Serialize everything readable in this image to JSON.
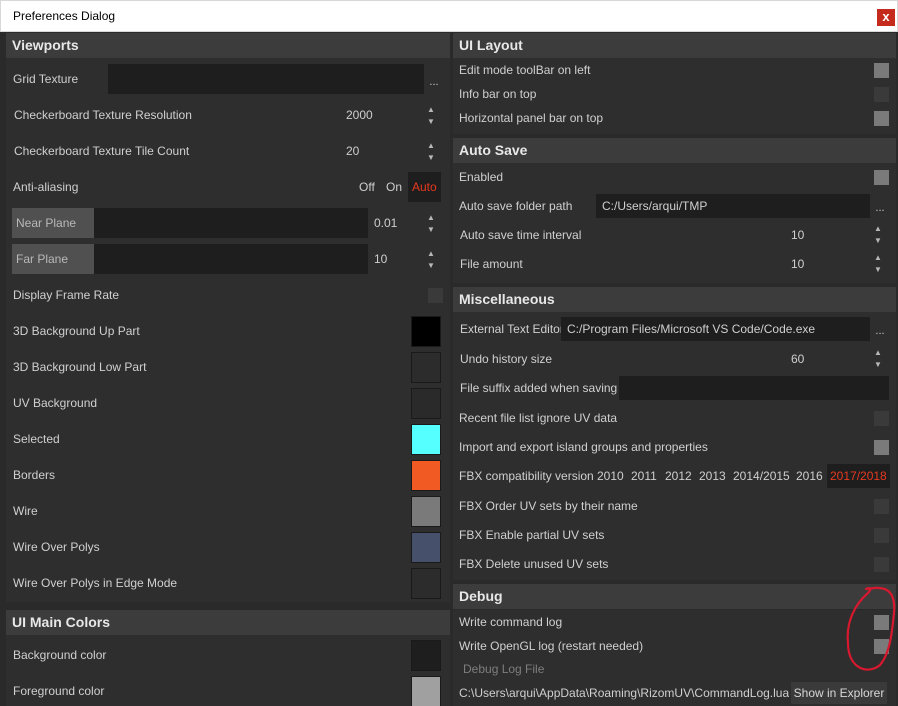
{
  "window": {
    "title": "Preferences Dialog",
    "close_glyph": "x"
  },
  "viewports": {
    "header": "Viewports",
    "grid_texture": {
      "label": "Grid Texture",
      "value": "",
      "browse": "..."
    },
    "checker_res": {
      "label": "Checkerboard Texture Resolution",
      "value": "2000"
    },
    "checker_tile": {
      "label": "Checkerboard Texture Tile Count",
      "value": "20"
    },
    "antialiasing": {
      "label": "Anti-aliasing",
      "options": [
        "Off",
        "On",
        "Auto"
      ],
      "selected": "Auto"
    },
    "near_plane": {
      "label": "Near Plane",
      "value": "0.01"
    },
    "far_plane": {
      "label": "Far Plane",
      "value": "10"
    },
    "display_frame_rate": {
      "label": "Display Frame Rate",
      "checked": false
    },
    "colors": [
      {
        "label": "3D Background Up Part",
        "color": "#000000"
      },
      {
        "label": "3D Background Low Part",
        "color": "#2c2c2c"
      },
      {
        "label": "UV Background",
        "color": "#2a2a2a"
      },
      {
        "label": "Selected",
        "color": "#55ffff"
      },
      {
        "label": "Borders",
        "color": "#f25a24"
      },
      {
        "label": "Wire",
        "color": "#7a7a7a"
      },
      {
        "label": "Wire Over Polys",
        "color": "#46506a"
      },
      {
        "label": "Wire Over Polys in Edge Mode",
        "color": "#2c2c2c"
      }
    ]
  },
  "ui_main_colors": {
    "header": "UI Main Colors",
    "colors": [
      {
        "label": "Background color",
        "color": "#1e1e1e"
      },
      {
        "label": "Foreground color",
        "color": "#a0a0a0"
      }
    ]
  },
  "ui_layout": {
    "header": "UI Layout",
    "items": [
      {
        "label": "Edit mode toolBar on left",
        "checked": true
      },
      {
        "label": "Info bar on top",
        "checked": false
      },
      {
        "label": "Horizontal panel bar on top",
        "checked": true
      }
    ]
  },
  "auto_save": {
    "header": "Auto Save",
    "enabled": {
      "label": "Enabled",
      "checked": true
    },
    "folder": {
      "label": "Auto save folder path",
      "value": "C:/Users/arqui/TMP",
      "browse": "..."
    },
    "interval": {
      "label": "Auto save time interval",
      "value": "10"
    },
    "amount": {
      "label": "File amount",
      "value": "10"
    }
  },
  "misc": {
    "header": "Miscellaneous",
    "editor": {
      "label": "External Text Editor",
      "value": "C:/Program Files/Microsoft VS Code/Code.exe",
      "browse": "..."
    },
    "undo": {
      "label": "Undo history size",
      "value": "60"
    },
    "suffix": {
      "label": "File suffix added when saving",
      "value": ""
    },
    "recent_ignore": {
      "label": "Recent file list ignore UV data",
      "checked": false
    },
    "island_groups": {
      "label": "Import and export island groups and properties",
      "checked": true
    },
    "fbx_version": {
      "label": "FBX compatibility version",
      "options": [
        "2010",
        "2011",
        "2012",
        "2013",
        "2014/2015",
        "2016",
        "2017/2018"
      ],
      "selected": "2017/2018"
    },
    "fbx_order": {
      "label": "FBX Order UV sets by their name",
      "checked": false
    },
    "fbx_partial": {
      "label": "FBX Enable partial UV sets",
      "checked": false
    },
    "fbx_delete": {
      "label": "FBX Delete unused UV sets",
      "checked": false
    }
  },
  "debug": {
    "header": "Debug",
    "command_log": {
      "label": "Write command log",
      "checked": true
    },
    "opengl_log": {
      "label": "Write OpenGL log (restart needed)",
      "checked": true
    },
    "log_file_label": "Debug Log File",
    "log_path": "C:\\Users\\arqui\\AppData\\Roaming\\RizomUV\\CommandLog.lua",
    "show_in_explorer": "Show in Explorer"
  },
  "spin_up": "▲",
  "spin_down": "▼",
  "annotation_color": "#d8182e"
}
